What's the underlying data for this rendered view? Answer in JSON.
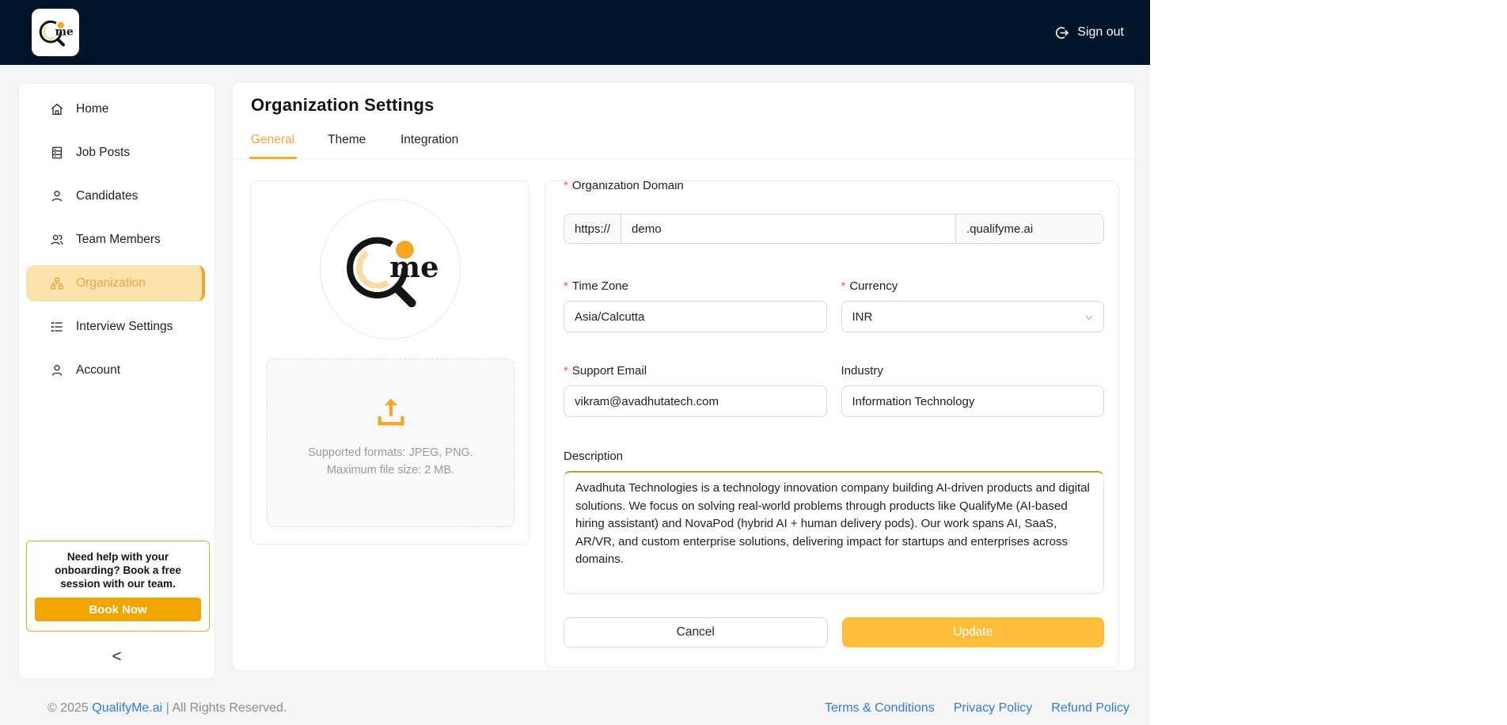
{
  "colors": {
    "header_bg": "#001529",
    "accent_amber": "#f5a623",
    "active_nav_bg": "#fbe3ae",
    "active_nav_text": "#efa63c",
    "update_button": "#fcbd39",
    "book_now_button": "#f0a500",
    "link_blue": "#2d7dd8",
    "required_red": "#ff4d4f"
  },
  "header": {
    "brand_text": "me",
    "sign_out": "Sign out"
  },
  "sidebar": {
    "items": [
      {
        "label": "Home",
        "icon": "home-icon",
        "active": false
      },
      {
        "label": "Job Posts",
        "icon": "job-posts-icon",
        "active": false
      },
      {
        "label": "Candidates",
        "icon": "user-icon",
        "active": false
      },
      {
        "label": "Team Members",
        "icon": "team-icon",
        "active": false
      },
      {
        "label": "Organization",
        "icon": "org-chart-icon",
        "active": true
      },
      {
        "label": "Interview Settings",
        "icon": "list-icon",
        "active": false
      },
      {
        "label": "Account",
        "icon": "user-icon",
        "active": false
      }
    ],
    "help": {
      "line1": "Need help with your",
      "line2": "onboarding? Book a free",
      "line3": "session with our team.",
      "cta": "Book Now"
    },
    "collapse_glyph": "<"
  },
  "main": {
    "title": "Organization Settings",
    "tabs": [
      {
        "label": "General",
        "active": true
      },
      {
        "label": "Theme",
        "active": false
      },
      {
        "label": "Integration",
        "active": false
      }
    ],
    "logo_card": {
      "brand_text": "me",
      "formats_line": "Supported formats: JPEG, PNG.",
      "size_line": "Maximum file size: 2 MB."
    },
    "form": {
      "required_marker": "*",
      "domain": {
        "label": "Organization Domain",
        "prefix": "https://",
        "value": "demo",
        "suffix": ".qualifyme.ai"
      },
      "timezone": {
        "label": "Time Zone",
        "value": "Asia/Calcutta"
      },
      "currency": {
        "label": "Currency",
        "value": "INR"
      },
      "support_email": {
        "label": "Support Email",
        "value": "vikram@avadhutatech.com"
      },
      "industry": {
        "label": "Industry",
        "value": "Information Technology"
      },
      "description": {
        "label": "Description",
        "value": "Avadhuta Technologies is a technology innovation company building AI-driven products and digital solutions. We focus on solving real-world problems through products like QualifyMe (AI-based hiring assistant) and NovaPod (hybrid AI + human delivery pods). Our work spans AI, SaaS, AR/VR, and custom enterprise solutions, delivering impact for startups and enterprises across domains."
      },
      "cancel_label": "Cancel",
      "update_label": "Update"
    }
  },
  "footer": {
    "copyright_prefix": "© 2025 ",
    "brand_link": "QualifyMe.ai",
    "copyright_suffix": " | All Rights Reserved.",
    "links": [
      {
        "label": "Terms & Conditions"
      },
      {
        "label": "Privacy Policy"
      },
      {
        "label": "Refund Policy"
      }
    ]
  }
}
